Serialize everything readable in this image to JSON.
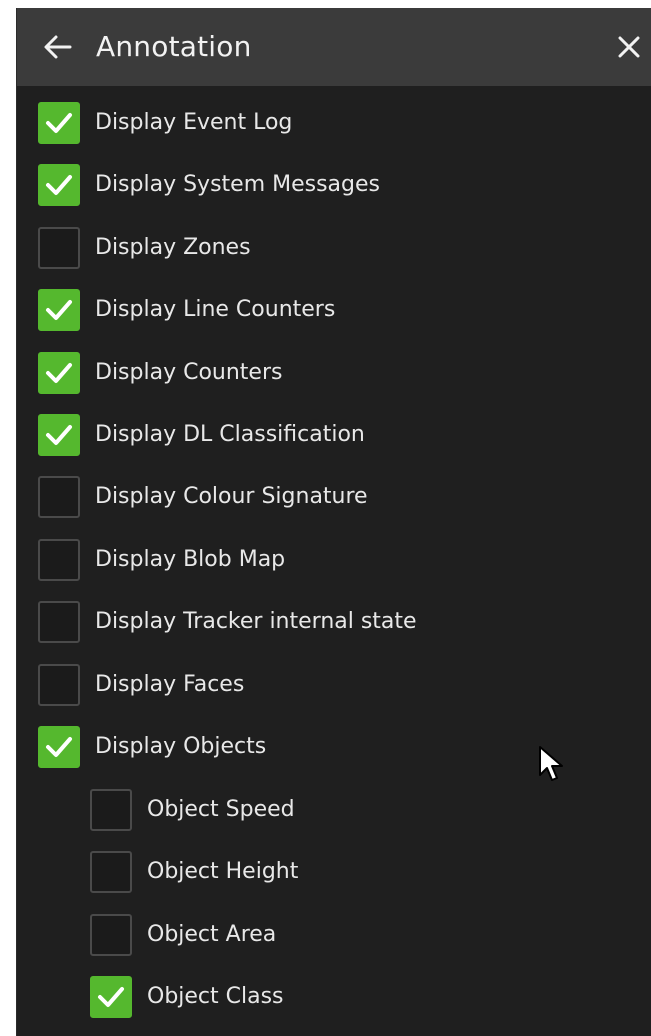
{
  "header": {
    "title": "Annotation",
    "back_icon": "arrow-left-icon",
    "close_icon": "close-icon"
  },
  "options": [
    {
      "label": "Display Event Log",
      "checked": true
    },
    {
      "label": "Display System Messages",
      "checked": true
    },
    {
      "label": "Display Zones",
      "checked": false
    },
    {
      "label": "Display Line Counters",
      "checked": true
    },
    {
      "label": "Display Counters",
      "checked": true
    },
    {
      "label": "Display DL Classification",
      "checked": true
    },
    {
      "label": "Display Colour Signature",
      "checked": false
    },
    {
      "label": "Display Blob Map",
      "checked": false
    },
    {
      "label": "Display Tracker internal state",
      "checked": false
    },
    {
      "label": "Display Faces",
      "checked": false
    },
    {
      "label": "Display Objects",
      "checked": true
    }
  ],
  "object_options": [
    {
      "label": "Object Speed",
      "checked": false
    },
    {
      "label": "Object Height",
      "checked": false
    },
    {
      "label": "Object Area",
      "checked": false
    },
    {
      "label": "Object Class",
      "checked": true
    }
  ],
  "colors": {
    "panel_bg": "#1f1f1f",
    "header_bg": "#3b3b3b",
    "check_green": "#55b82e",
    "text": "#e8e8e8"
  }
}
